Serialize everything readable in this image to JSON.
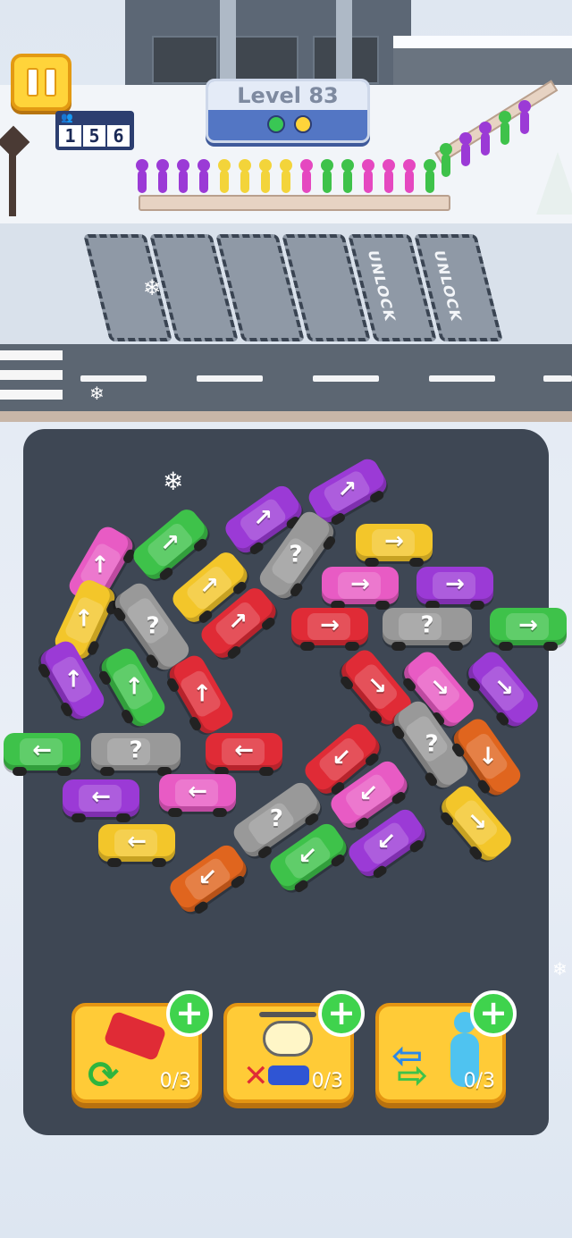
{
  "hud": {
    "level_label": "Level 83",
    "counter_digits": [
      "1",
      "5",
      "6"
    ],
    "counter_label": "≈≈",
    "progress_dots": [
      "#39c754",
      "#ffd43a"
    ]
  },
  "queue": {
    "colors": [
      "#9b3ad6",
      "#9b3ad6",
      "#9b3ad6",
      "#9b3ad6",
      "#f3d43a",
      "#f3d43a",
      "#f3d43a",
      "#f3d43a",
      "#e548c0",
      "#3ec24a",
      "#3ec24a",
      "#e548c0",
      "#e548c0",
      "#e548c0",
      "#3ec24a",
      "#3ec24a",
      "#9b3ad6",
      "#9b3ad6",
      "#3ec24a",
      "#9b3ad6"
    ]
  },
  "parking": {
    "unlock_label": "UNLOCK",
    "slots": [
      "empty",
      "empty",
      "empty",
      "empty",
      "locked",
      "locked"
    ]
  },
  "cars": [
    {
      "color": "#e85bc4",
      "arrow": "↑"
    },
    {
      "color": "#3ec24a",
      "arrow": "↗"
    },
    {
      "color": "#9b3ad6",
      "arrow": "↗"
    },
    {
      "color": "#9b3ad6",
      "arrow": "↗"
    },
    {
      "color": "#f3c62a",
      "arrow": "→"
    },
    {
      "color": "#999999",
      "arrow": "?"
    },
    {
      "color": "#f3c62a",
      "arrow": "↗"
    },
    {
      "color": "#f3c62a",
      "arrow": "↑"
    },
    {
      "color": "#999999",
      "arrow": "?"
    },
    {
      "color": "#e02b36",
      "arrow": "↗"
    },
    {
      "color": "#e85bc4",
      "arrow": "→"
    },
    {
      "color": "#9b3ad6",
      "arrow": "→"
    },
    {
      "color": "#e02b36",
      "arrow": "→"
    },
    {
      "color": "#999999",
      "arrow": "?"
    },
    {
      "color": "#3ec24a",
      "arrow": "→"
    },
    {
      "color": "#9b3ad6",
      "arrow": "↑"
    },
    {
      "color": "#3ec24a",
      "arrow": "↑"
    },
    {
      "color": "#e02b36",
      "arrow": "↑"
    },
    {
      "color": "#e02b36",
      "arrow": "↘"
    },
    {
      "color": "#e85bc4",
      "arrow": "↘"
    },
    {
      "color": "#9b3ad6",
      "arrow": "↘"
    },
    {
      "color": "#3ec24a",
      "arrow": "←"
    },
    {
      "color": "#999999",
      "arrow": "?"
    },
    {
      "color": "#e02b36",
      "arrow": "←"
    },
    {
      "color": "#999999",
      "arrow": "?"
    },
    {
      "color": "#e0651e",
      "arrow": "↓"
    },
    {
      "color": "#9b3ad6",
      "arrow": "←"
    },
    {
      "color": "#e85bc4",
      "arrow": "←"
    },
    {
      "color": "#e02b36",
      "arrow": "↙"
    },
    {
      "color": "#e85bc4",
      "arrow": "↙"
    },
    {
      "color": "#999999",
      "arrow": "?"
    },
    {
      "color": "#f3c62a",
      "arrow": "↘"
    },
    {
      "color": "#f3c62a",
      "arrow": "←"
    },
    {
      "color": "#3ec24a",
      "arrow": "↙"
    },
    {
      "color": "#9b3ad6",
      "arrow": "↙"
    },
    {
      "color": "#e0651e",
      "arrow": "↙"
    }
  ],
  "boosters": [
    {
      "name": "shuffle",
      "count": "0/3"
    },
    {
      "name": "helicopter",
      "count": "0/3"
    },
    {
      "name": "swap-passenger",
      "count": "0/3"
    }
  ]
}
